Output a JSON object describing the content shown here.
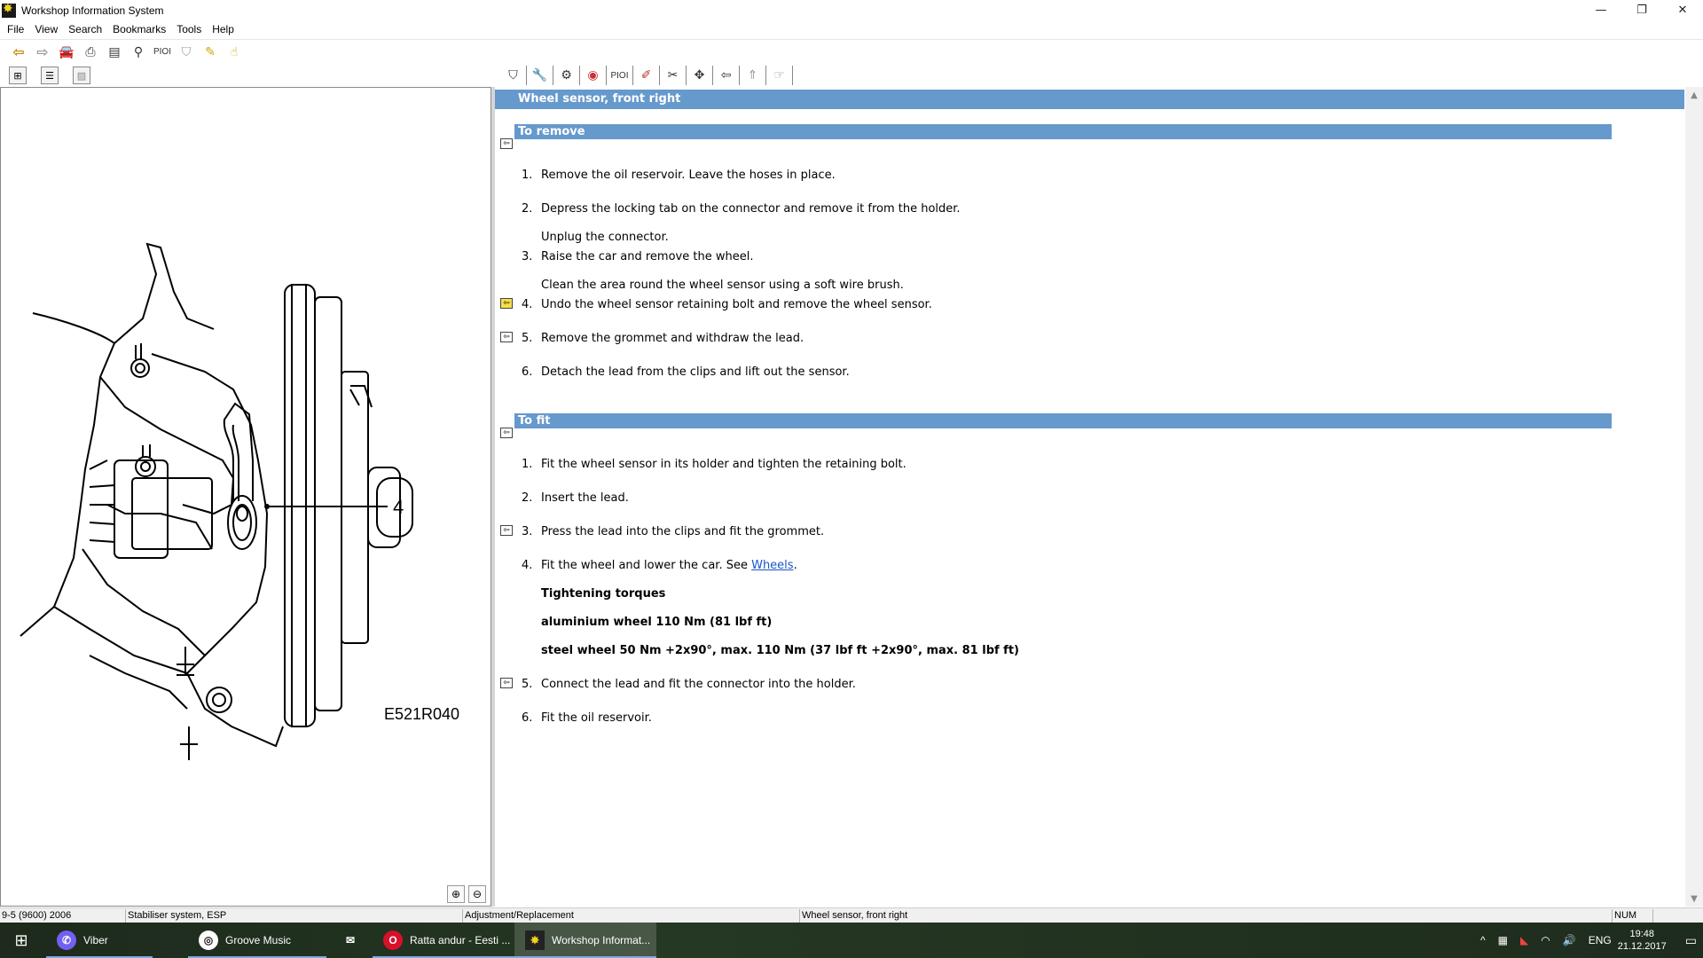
{
  "window": {
    "title": "Workshop Information System",
    "controls": [
      "—",
      "❐",
      "✕"
    ]
  },
  "menu": [
    "File",
    "View",
    "Search",
    "Bookmarks",
    "Tools",
    "Help"
  ],
  "toolbar": {
    "pioi_label": "PIOI"
  },
  "right_toolbar": {
    "pioi_label": "PIOI"
  },
  "figure": {
    "callout": "4",
    "code": "E521R040"
  },
  "content": {
    "heading": "Wheel sensor, front right",
    "remove": {
      "title": "To remove",
      "steps": [
        {
          "num": "1.",
          "text": "Remove the oil reservoir. Leave the hoses in place."
        },
        {
          "num": "2.",
          "text": "Depress the locking tab on the connector and remove it from the holder."
        },
        {
          "num": "3.",
          "text": "Raise the car and remove the wheel."
        },
        {
          "num": "4.",
          "text": "Undo the wheel sensor retaining bolt and remove the wheel sensor."
        },
        {
          "num": "5.",
          "text": "Remove the grommet and withdraw the lead."
        },
        {
          "num": "6.",
          "text": "Detach the lead from the clips and lift out the sensor."
        }
      ],
      "notes": [
        "Unplug the connector.",
        "Clean the area round the wheel sensor using a soft wire brush."
      ]
    },
    "fit": {
      "title": "To fit",
      "steps": [
        {
          "num": "1.",
          "text": "Fit the wheel sensor in its holder and tighten the retaining bolt."
        },
        {
          "num": "2.",
          "text": "Insert the lead."
        },
        {
          "num": "3.",
          "text": "Press the lead into the clips and fit the grommet."
        },
        {
          "num": "4.",
          "text": "Fit the wheel and lower the car. See ",
          "link": "Wheels",
          "after": "."
        },
        {
          "num": "5.",
          "text": "Connect the lead and fit the connector into the holder."
        },
        {
          "num": "6.",
          "text": "Fit the oil reservoir."
        }
      ],
      "torque_title": "Tightening torques",
      "torque_alu": "aluminium wheel 110 Nm (81 lbf ft)",
      "torque_steel": "steel wheel 50 Nm +2x90°, max. 110 Nm (37 lbf ft +2x90°, max. 81 lbf ft)"
    }
  },
  "status": {
    "model": "9-5 (9600) 2006",
    "system": "Stabiliser system, ESP",
    "operation": "Adjustment/Replacement",
    "item": "Wheel sensor, front right",
    "num": "NUM"
  },
  "taskbar": {
    "apps": [
      {
        "label": "Viber"
      },
      {
        "label": "Groove Music"
      },
      {
        "label": ""
      },
      {
        "label": "Ratta andur - Eesti ..."
      },
      {
        "label": "Workshop Informat..."
      }
    ],
    "lang": "ENG",
    "time": "19:48",
    "date": "21.12.2017"
  }
}
